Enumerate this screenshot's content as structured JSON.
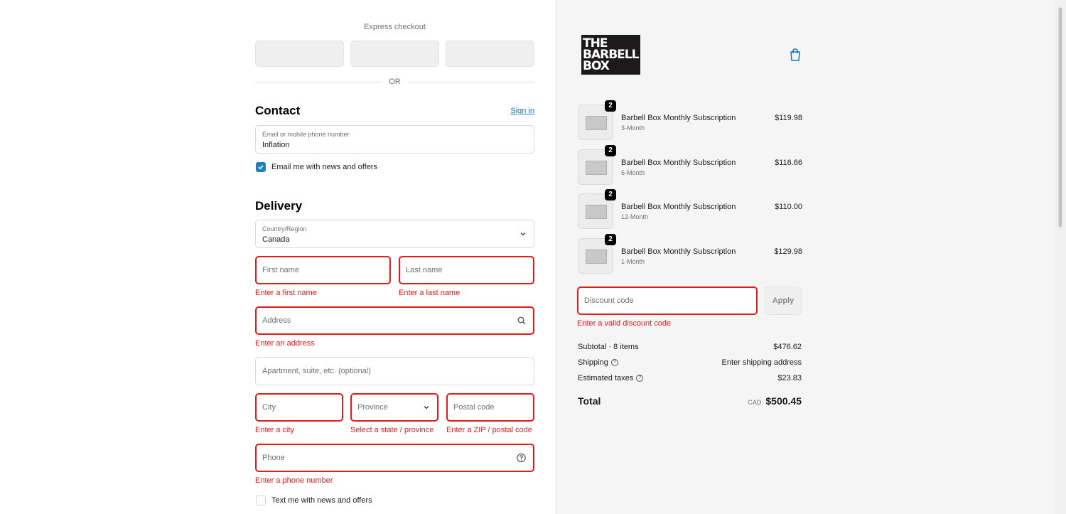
{
  "express": {
    "title": "Express checkout",
    "or": "OR"
  },
  "contact": {
    "heading": "Contact",
    "sign_in": "Sign in",
    "email_label": "Email or mobile phone number",
    "email_value": "Inflation",
    "news_label": "Email me with news and offers",
    "news_checked": true
  },
  "delivery": {
    "heading": "Delivery",
    "country_label": "Country/Region",
    "country_value": "Canada",
    "first_name_ph": "First name",
    "first_name_err": "Enter a first name",
    "last_name_ph": "Last name",
    "last_name_err": "Enter a last name",
    "address_ph": "Address",
    "address_err": "Enter an address",
    "apartment_ph": "Apartment, suite, etc. (optional)",
    "city_ph": "City",
    "city_err": "Enter a city",
    "province_ph": "Province",
    "province_err": "Select a state / province",
    "postal_ph": "Postal code",
    "postal_err": "Enter a ZIP / postal code",
    "phone_ph": "Phone",
    "phone_err": "Enter a phone number",
    "text_label": "Text me with news and offers"
  },
  "brand": {
    "logo_lines": [
      "THE",
      "BARBELL",
      "BOX"
    ]
  },
  "cart": {
    "items": [
      {
        "qty": "2",
        "name": "Barbell Box Monthly Subscription",
        "variant": "3-Month",
        "price": "$119.98"
      },
      {
        "qty": "2",
        "name": "Barbell Box Monthly Subscription",
        "variant": "6-Month",
        "price": "$116.66"
      },
      {
        "qty": "2",
        "name": "Barbell Box Monthly Subscription",
        "variant": "12-Month",
        "price": "$110.00"
      },
      {
        "qty": "2",
        "name": "Barbell Box Monthly Subscription",
        "variant": "1-Month",
        "price": "$129.98"
      }
    ],
    "discount_ph": "Discount code",
    "discount_err": "Enter a valid discount code",
    "apply": "Apply",
    "subtotal_label": "Subtotal · 8 items",
    "subtotal_value": "$476.62",
    "shipping_label": "Shipping",
    "shipping_value": "Enter shipping address",
    "taxes_label": "Estimated taxes",
    "taxes_value": "$23.83",
    "total_label": "Total",
    "total_currency": "CAD",
    "total_value": "$500.45"
  },
  "colors": {
    "error": "#dd1d1d",
    "link": "#1773b0",
    "checkbox": "#1f80c0"
  }
}
